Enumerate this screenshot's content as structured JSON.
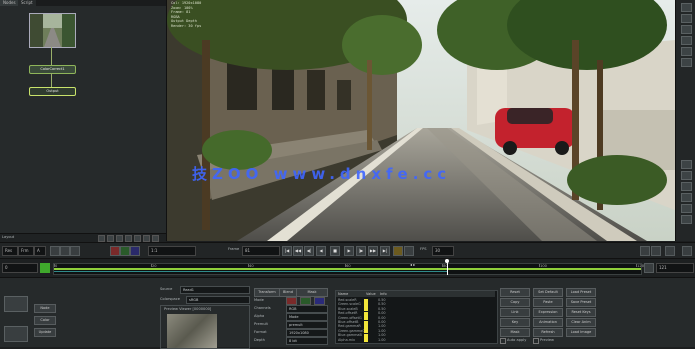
{
  "node_panel": {
    "tabs": [
      "Nodes",
      "Script"
    ],
    "nodes": [
      {
        "label": "Read1",
        "kind": "read"
      },
      {
        "label": "ColorCorrect1",
        "kind": "effect"
      },
      {
        "label": "Output",
        "kind": "output"
      }
    ],
    "footer_label": "Layout"
  },
  "viewer": {
    "hud_lines": [
      "Col: 1920x1080",
      "Zoom: 100%",
      "Frame: 81",
      "RGBA",
      "Output Depth",
      "Render: 30 fps"
    ],
    "watermark": "技ZOO  www.dnxfe.cc"
  },
  "right_bar": {
    "icons": [
      "pointer-icon",
      "hand-icon",
      "zoom-icon",
      "crop-icon",
      "color-picker-icon",
      "roi-icon",
      "wipe-icon",
      "overlay-icon",
      "grid-icon",
      "guides-icon",
      "lut-icon",
      "snapshot-icon"
    ]
  },
  "transport": {
    "fps": "24",
    "frame_label": "Frame",
    "frame_value": "81",
    "fps_label": "FPS",
    "fps_value": "30",
    "buttons": [
      "|◀",
      "◀◀",
      "◀|",
      "◀",
      "■",
      "▶",
      "|▶",
      "▶▶",
      "▶|"
    ],
    "zoom_field": "1:1",
    "left_fields": [
      "Res",
      "Frm",
      "A"
    ]
  },
  "timeline": {
    "start": "0",
    "end": "121",
    "current": "81",
    "ticks": [
      "0",
      "20",
      "40",
      "60",
      "80",
      "100",
      "120"
    ],
    "loop_label": "◂ ▸",
    "in_point_color": "#3fa82c"
  },
  "properties": {
    "left_buttons": [
      "Node",
      "Color",
      "Update"
    ],
    "source_label": "Source",
    "source_value": "Read1",
    "colorspace_label": "Colorspace",
    "colorspace_value": "sRGB",
    "preview_label": "Preview Viewer [0000000]",
    "mid_labels": [
      "Mode",
      "Channels",
      "Alpha",
      "Premult",
      "Format",
      "Depth",
      "Gamma"
    ],
    "mid_tabs": [
      "Transform",
      "Blend",
      "Mask"
    ],
    "mid_fields": [
      "RGB",
      "Mode",
      "premult",
      "1920x1080",
      "8 bit",
      "linear"
    ],
    "channel_table": {
      "headers": [
        "Name",
        "Value",
        "Info"
      ],
      "rows": [
        {
          "name": "Red.scaleR",
          "value": "0.50"
        },
        {
          "name": "Green.scaleG",
          "value": "0.50"
        },
        {
          "name": "Blue.scaleB",
          "value": "0.50"
        },
        {
          "name": "Red.offsetR",
          "value": "0.00"
        },
        {
          "name": "Green.offsetG",
          "value": "0.00"
        },
        {
          "name": "Blue.offsetB",
          "value": "0.00"
        },
        {
          "name": "Red.gammaR",
          "value": "1.00"
        },
        {
          "name": "Green.gammaG",
          "value": "1.00"
        },
        {
          "name": "Blue.gammaB",
          "value": "1.00"
        },
        {
          "name": "Alpha.mix",
          "value": "1.00"
        }
      ]
    },
    "right_buttons": [
      [
        "Reset",
        "Set Default",
        "Load Preset"
      ],
      [
        "Copy",
        "Paste",
        "Save Preset"
      ],
      [
        "Link",
        "Expression",
        "Reset Keys"
      ],
      [
        "Key",
        "Animation",
        "Clear Anim"
      ],
      [
        "Mask",
        "Refresh",
        "Load Image"
      ]
    ],
    "checkbox_labels": [
      "Auto apply",
      "Preview"
    ]
  },
  "colors": {
    "accent": "#8fcf3a",
    "watermark": "#3f66ff",
    "bar_yellow": "#f2e53a"
  }
}
